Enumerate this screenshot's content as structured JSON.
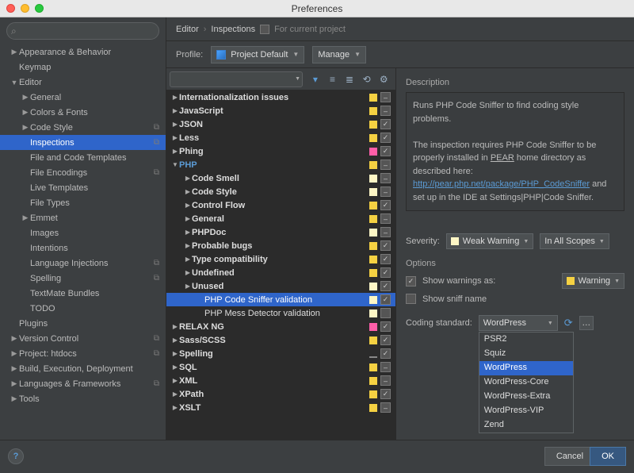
{
  "window": {
    "title": "Preferences"
  },
  "crumb": {
    "a": "Editor",
    "b": "Inspections",
    "proj": "For current project"
  },
  "profile": {
    "label": "Profile:",
    "value": "Project Default",
    "manage": "Manage"
  },
  "sidebar": {
    "items": [
      {
        "label": "Appearance & Behavior",
        "depth": 0,
        "arrow": "▶"
      },
      {
        "label": "Keymap",
        "depth": 0,
        "arrow": ""
      },
      {
        "label": "Editor",
        "depth": 0,
        "arrow": "▼"
      },
      {
        "label": "General",
        "depth": 1,
        "arrow": "▶"
      },
      {
        "label": "Colors & Fonts",
        "depth": 1,
        "arrow": "▶"
      },
      {
        "label": "Code Style",
        "depth": 1,
        "arrow": "▶",
        "glyph": "⧉"
      },
      {
        "label": "Inspections",
        "depth": 1,
        "arrow": "",
        "selected": true,
        "glyph": "⧉"
      },
      {
        "label": "File and Code Templates",
        "depth": 1,
        "arrow": ""
      },
      {
        "label": "File Encodings",
        "depth": 1,
        "arrow": "",
        "glyph": "⧉"
      },
      {
        "label": "Live Templates",
        "depth": 1,
        "arrow": ""
      },
      {
        "label": "File Types",
        "depth": 1,
        "arrow": ""
      },
      {
        "label": "Emmet",
        "depth": 1,
        "arrow": "▶"
      },
      {
        "label": "Images",
        "depth": 1,
        "arrow": ""
      },
      {
        "label": "Intentions",
        "depth": 1,
        "arrow": ""
      },
      {
        "label": "Language Injections",
        "depth": 1,
        "arrow": "",
        "glyph": "⧉"
      },
      {
        "label": "Spelling",
        "depth": 1,
        "arrow": "",
        "glyph": "⧉"
      },
      {
        "label": "TextMate Bundles",
        "depth": 1,
        "arrow": ""
      },
      {
        "label": "TODO",
        "depth": 1,
        "arrow": ""
      },
      {
        "label": "Plugins",
        "depth": 0,
        "arrow": ""
      },
      {
        "label": "Version Control",
        "depth": 0,
        "arrow": "▶",
        "glyph": "⧉"
      },
      {
        "label": "Project: htdocs",
        "depth": 0,
        "arrow": "▶",
        "glyph": "⧉"
      },
      {
        "label": "Build, Execution, Deployment",
        "depth": 0,
        "arrow": "▶"
      },
      {
        "label": "Languages & Frameworks",
        "depth": 0,
        "arrow": "▶",
        "glyph": "⧉"
      },
      {
        "label": "Tools",
        "depth": 0,
        "arrow": "▶"
      }
    ]
  },
  "itree": [
    {
      "l": 1,
      "arrow": "▶",
      "txt": "Internationalization issues",
      "badge": "sq-yellow",
      "chk": "–"
    },
    {
      "l": 1,
      "arrow": "▶",
      "txt": "JavaScript",
      "badge": "sq-yellow",
      "chk": "–"
    },
    {
      "l": 1,
      "arrow": "▶",
      "txt": "JSON",
      "badge": "sq-yellow",
      "chk": "✓"
    },
    {
      "l": 1,
      "arrow": "▶",
      "txt": "Less",
      "badge": "sq-yellow",
      "chk": "✓"
    },
    {
      "l": 1,
      "arrow": "▶",
      "txt": "Phing",
      "badge": "sq-pink",
      "chk": "✓"
    },
    {
      "l": 1,
      "arrow": "▼",
      "txt": "PHP",
      "badge": "sq-yellow",
      "chk": "–",
      "hl": true
    },
    {
      "l": 2,
      "arrow": "▶",
      "txt": "Code Smell",
      "badge": "sq-cream",
      "chk": "–"
    },
    {
      "l": 2,
      "arrow": "▶",
      "txt": "Code Style",
      "badge": "sq-cream",
      "chk": "–"
    },
    {
      "l": 2,
      "arrow": "▶",
      "txt": "Control Flow",
      "badge": "sq-yellow",
      "chk": "✓"
    },
    {
      "l": 2,
      "arrow": "▶",
      "txt": "General",
      "badge": "sq-yellow",
      "chk": "–"
    },
    {
      "l": 2,
      "arrow": "▶",
      "txt": "PHPDoc",
      "badge": "sq-cream",
      "chk": "–"
    },
    {
      "l": 2,
      "arrow": "▶",
      "txt": "Probable bugs",
      "badge": "sq-yellow",
      "chk": "✓"
    },
    {
      "l": 2,
      "arrow": "▶",
      "txt": "Type compatibility",
      "badge": "sq-yellow",
      "chk": "✓"
    },
    {
      "l": 2,
      "arrow": "▶",
      "txt": "Undefined",
      "badge": "sq-yellow",
      "chk": "✓"
    },
    {
      "l": 2,
      "arrow": "▶",
      "txt": "Unused",
      "badge": "sq-cream",
      "chk": "✓"
    },
    {
      "l": 3,
      "arrow": "",
      "txt": "PHP Code Sniffer validation",
      "badge": "sq-cream",
      "chk": "✓",
      "sel": true,
      "norm": true
    },
    {
      "l": 3,
      "arrow": "",
      "txt": "PHP Mess Detector validation",
      "badge": "sq-cream",
      "chk": "",
      "norm": true
    },
    {
      "l": 1,
      "arrow": "▶",
      "txt": "RELAX NG",
      "badge": "sq-pink",
      "chk": "✓"
    },
    {
      "l": 1,
      "arrow": "▶",
      "txt": "Sass/SCSS",
      "badge": "sq-yellow",
      "chk": "✓"
    },
    {
      "l": 1,
      "arrow": "▶",
      "txt": "Spelling",
      "badge": "sq-dash",
      "chk": "✓"
    },
    {
      "l": 1,
      "arrow": "▶",
      "txt": "SQL",
      "badge": "sq-yellow",
      "chk": "–"
    },
    {
      "l": 1,
      "arrow": "▶",
      "txt": "XML",
      "badge": "sq-yellow",
      "chk": "–"
    },
    {
      "l": 1,
      "arrow": "▶",
      "txt": "XPath",
      "badge": "sq-yellow",
      "chk": "✓"
    },
    {
      "l": 1,
      "arrow": "▶",
      "txt": "XSLT",
      "badge": "sq-yellow",
      "chk": "–"
    }
  ],
  "right": {
    "desc_title": "Description",
    "desc1": "Runs PHP Code Sniffer to find coding style problems.",
    "desc2a": "The inspection requires PHP Code Sniffer to be properly installed in ",
    "desc2b": "PEAR",
    "desc2c": " home directory as described here:",
    "link": "http://pear.php.net/package/PHP_CodeSniffer",
    "desc3": " and set up in the IDE at Settings|PHP|Code Sniffer.",
    "sev_label": "Severity:",
    "sev_value": "Weak Warning",
    "scope_value": "In All Scopes",
    "options_title": "Options",
    "opt1": "Show warnings as:",
    "opt1_dd": "Warning",
    "opt2": "Show sniff name",
    "cs_label": "Coding standard:",
    "cs_value": "WordPress",
    "cs_options": [
      "PSR2",
      "Squiz",
      "WordPress",
      "WordPress-Core",
      "WordPress-Extra",
      "WordPress-VIP",
      "Zend"
    ]
  },
  "footer": {
    "cancel": "Cancel",
    "ok": "OK"
  }
}
